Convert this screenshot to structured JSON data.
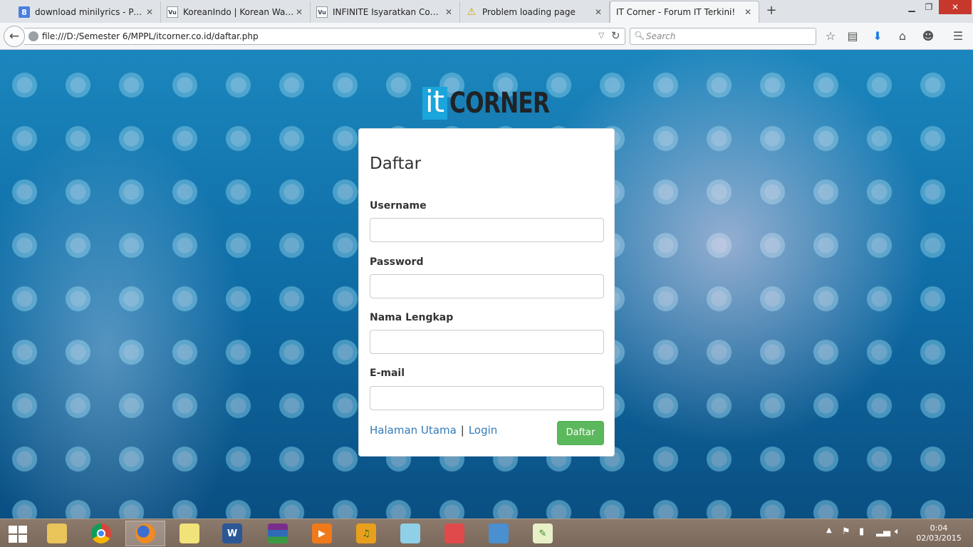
{
  "browser": {
    "tabs": [
      {
        "title": "download minilyrics - Pen...",
        "favicon": "google-g-icon",
        "favicon_text": "8",
        "active": false
      },
      {
        "title": "KoreanIndo | Korean Wave...",
        "favicon": "vu-icon",
        "favicon_text": "Vu",
        "active": false
      },
      {
        "title": "INFINITE Isyaratkan Come...",
        "favicon": "vu-icon",
        "favicon_text": "Vu",
        "active": false
      },
      {
        "title": "Problem loading page",
        "favicon": "warning-icon",
        "favicon_text": "⚠",
        "active": false
      },
      {
        "title": "IT Corner - Forum IT Terkini!",
        "favicon": "none",
        "favicon_text": "",
        "active": true
      }
    ],
    "url": "file:///D:/Semester 6/MPPL/itcorner.co.id/daftar.php",
    "search_placeholder": "Search"
  },
  "logo": {
    "part1": "it",
    "part2": "CORNER"
  },
  "form": {
    "heading": "Daftar",
    "fields": [
      {
        "label": "Username",
        "value": ""
      },
      {
        "label": "Password",
        "value": ""
      },
      {
        "label": "Nama Lengkap",
        "value": ""
      },
      {
        "label": "E-mail",
        "value": ""
      }
    ],
    "link_home": "Halaman Utama",
    "separator": "|",
    "link_login": "Login",
    "submit_label": "Daftar"
  },
  "taskbar": {
    "apps": [
      "file-explorer",
      "chrome",
      "firefox",
      "sticky-notes",
      "word",
      "winrar",
      "media-player",
      "music-player",
      "notepad",
      "paint",
      "photo-viewer",
      "editor"
    ],
    "active_app": "firefox",
    "clock_time": "0:04",
    "clock_date": "02/03/2015"
  },
  "colors": {
    "accent_link": "#337ab7",
    "button_green": "#5cb85c",
    "logo_blue": "#1aa5dc"
  }
}
